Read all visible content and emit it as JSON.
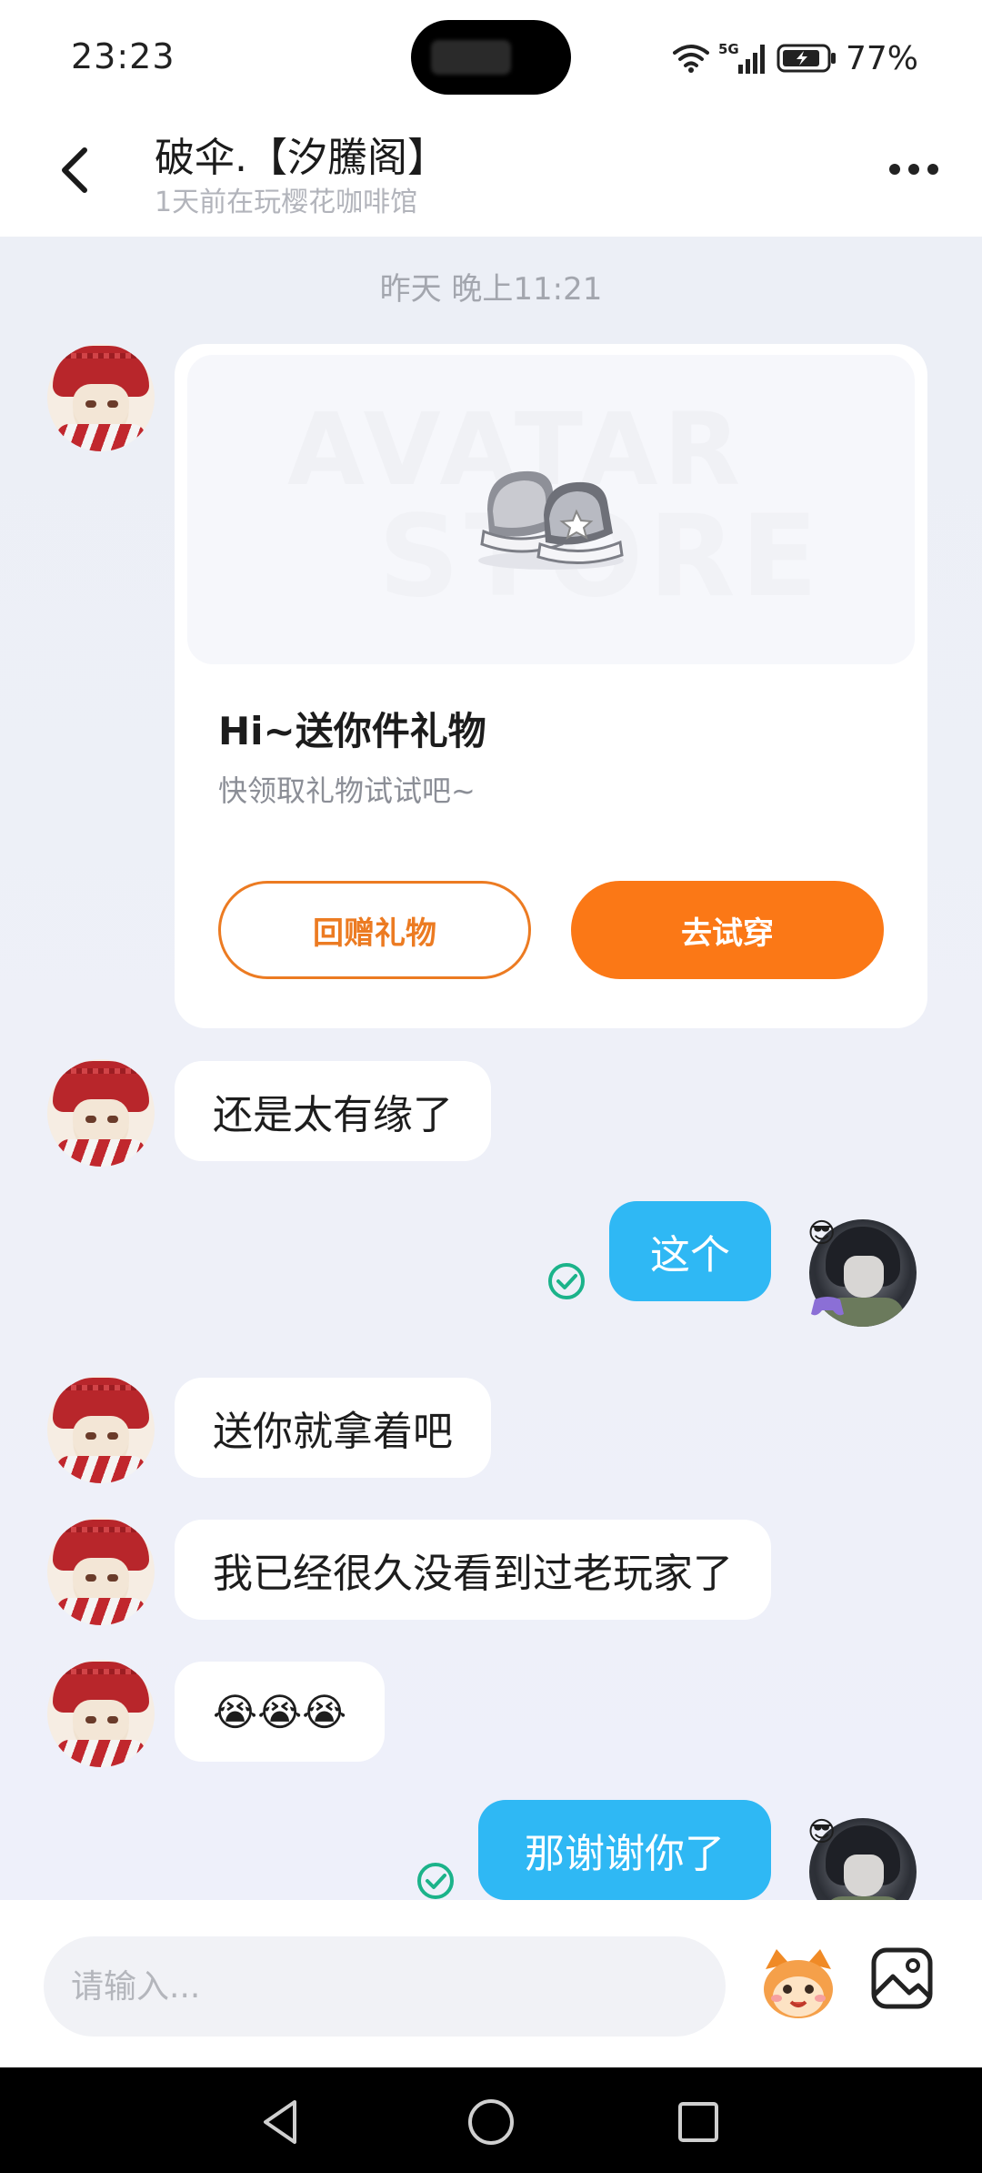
{
  "status_bar": {
    "time": "23:23",
    "network": "5G",
    "battery": "77%"
  },
  "header": {
    "title": "破伞.【汐騰阁】",
    "subtitle": "1天前在玩樱花咖啡馆"
  },
  "chat": {
    "timestamp": "昨天 晚上11:21",
    "gift_card": {
      "watermark_line1": "AVATAR",
      "watermark_line2": "STORE",
      "title": "Hi~送你件礼物",
      "subtitle": "快领取礼物试试吧~",
      "return_button": "回赠礼物",
      "try_button": "去试穿"
    },
    "messages": [
      {
        "from": "other",
        "text": "还是太有缘了"
      },
      {
        "from": "self",
        "text": "这个"
      },
      {
        "from": "other",
        "text": "送你就拿着吧"
      },
      {
        "from": "other",
        "text": "我已经很久没看到过老玩家了"
      },
      {
        "from": "other",
        "text": "😭😭😭"
      },
      {
        "from": "self",
        "text": "那谢谢你了"
      }
    ],
    "self_badge": "😎"
  },
  "input": {
    "placeholder": "请输入..."
  },
  "colors": {
    "accent_orange": "#fb7816",
    "self_bubble": "#2fb8f4",
    "read_check": "#1bb38a"
  },
  "icons": {
    "back": "chevron-left-icon",
    "more": "more-dots-icon",
    "sticker": "sticker-face-icon",
    "image": "image-icon",
    "read": "check-circle-icon"
  }
}
